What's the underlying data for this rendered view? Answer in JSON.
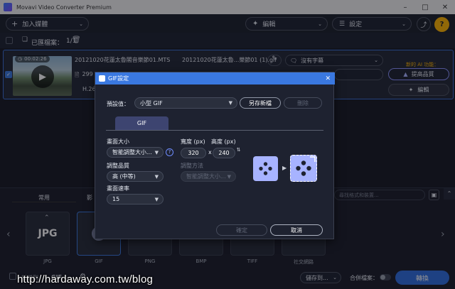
{
  "app": {
    "title": "Movavi Video Converter Premium"
  },
  "toolbar": {
    "add_media": "加入媒體",
    "edit": "編輯",
    "settings": "設定"
  },
  "files": {
    "label": "已匯檔案：",
    "count": "1/1"
  },
  "file": {
    "duration": "00:02:26",
    "source_name": "20121020花蓮太魯閣音樂節01.MTS",
    "output_name": "20121020花蓮太魯...樂節01 (1).gif",
    "size_partial": "299",
    "codec_partial": "H.26",
    "subtitles": "沒有字幕",
    "ai_label": "新的 AI 功能：",
    "enhance": "提高品質",
    "edit": "編輯"
  },
  "bottom": {
    "tabs": [
      "常用",
      "影"
    ],
    "search_placeholder": "尋找格式和裝置...",
    "formats": [
      "JPG",
      "GIF",
      "PNG",
      "BMP",
      "TIFF",
      "社交網路"
    ],
    "jpg_big": "JPG",
    "add_partial": "新增到",
    "output_format": "GIF",
    "save_to": "儲存到...",
    "merge": "合併檔案：",
    "convert": "轉換"
  },
  "dialog": {
    "title": "GIF設定",
    "preset_label": "預設值：",
    "preset_value": "小型 GIF",
    "save_new": "另存新檔",
    "delete": "刪除",
    "tab": "GIF",
    "frame_size_label": "畫面大小",
    "frame_size_value": "智能調整大小...",
    "width_label": "寬度 (px)",
    "height_label": "高度 (px)",
    "width_value": "320",
    "x_sep": "x",
    "height_value": "240",
    "quality_label": "調整品質",
    "quality_value": "高 (中等)",
    "resize_label": "調整方法",
    "resize_value": "智能調整大小...",
    "framerate_label": "畫面速率",
    "framerate_value": "15",
    "ok": "確定",
    "cancel": "取消",
    "help_icon_text": "?"
  },
  "watermark": "http://hardaway.com.tw/blog",
  "colors": {
    "accent": "#3a78e0",
    "ai_label": "#ffb400",
    "convert": "#2f6ee0",
    "dialog_tab": "#3d4470",
    "preview_icon": "#a7b3ff"
  }
}
